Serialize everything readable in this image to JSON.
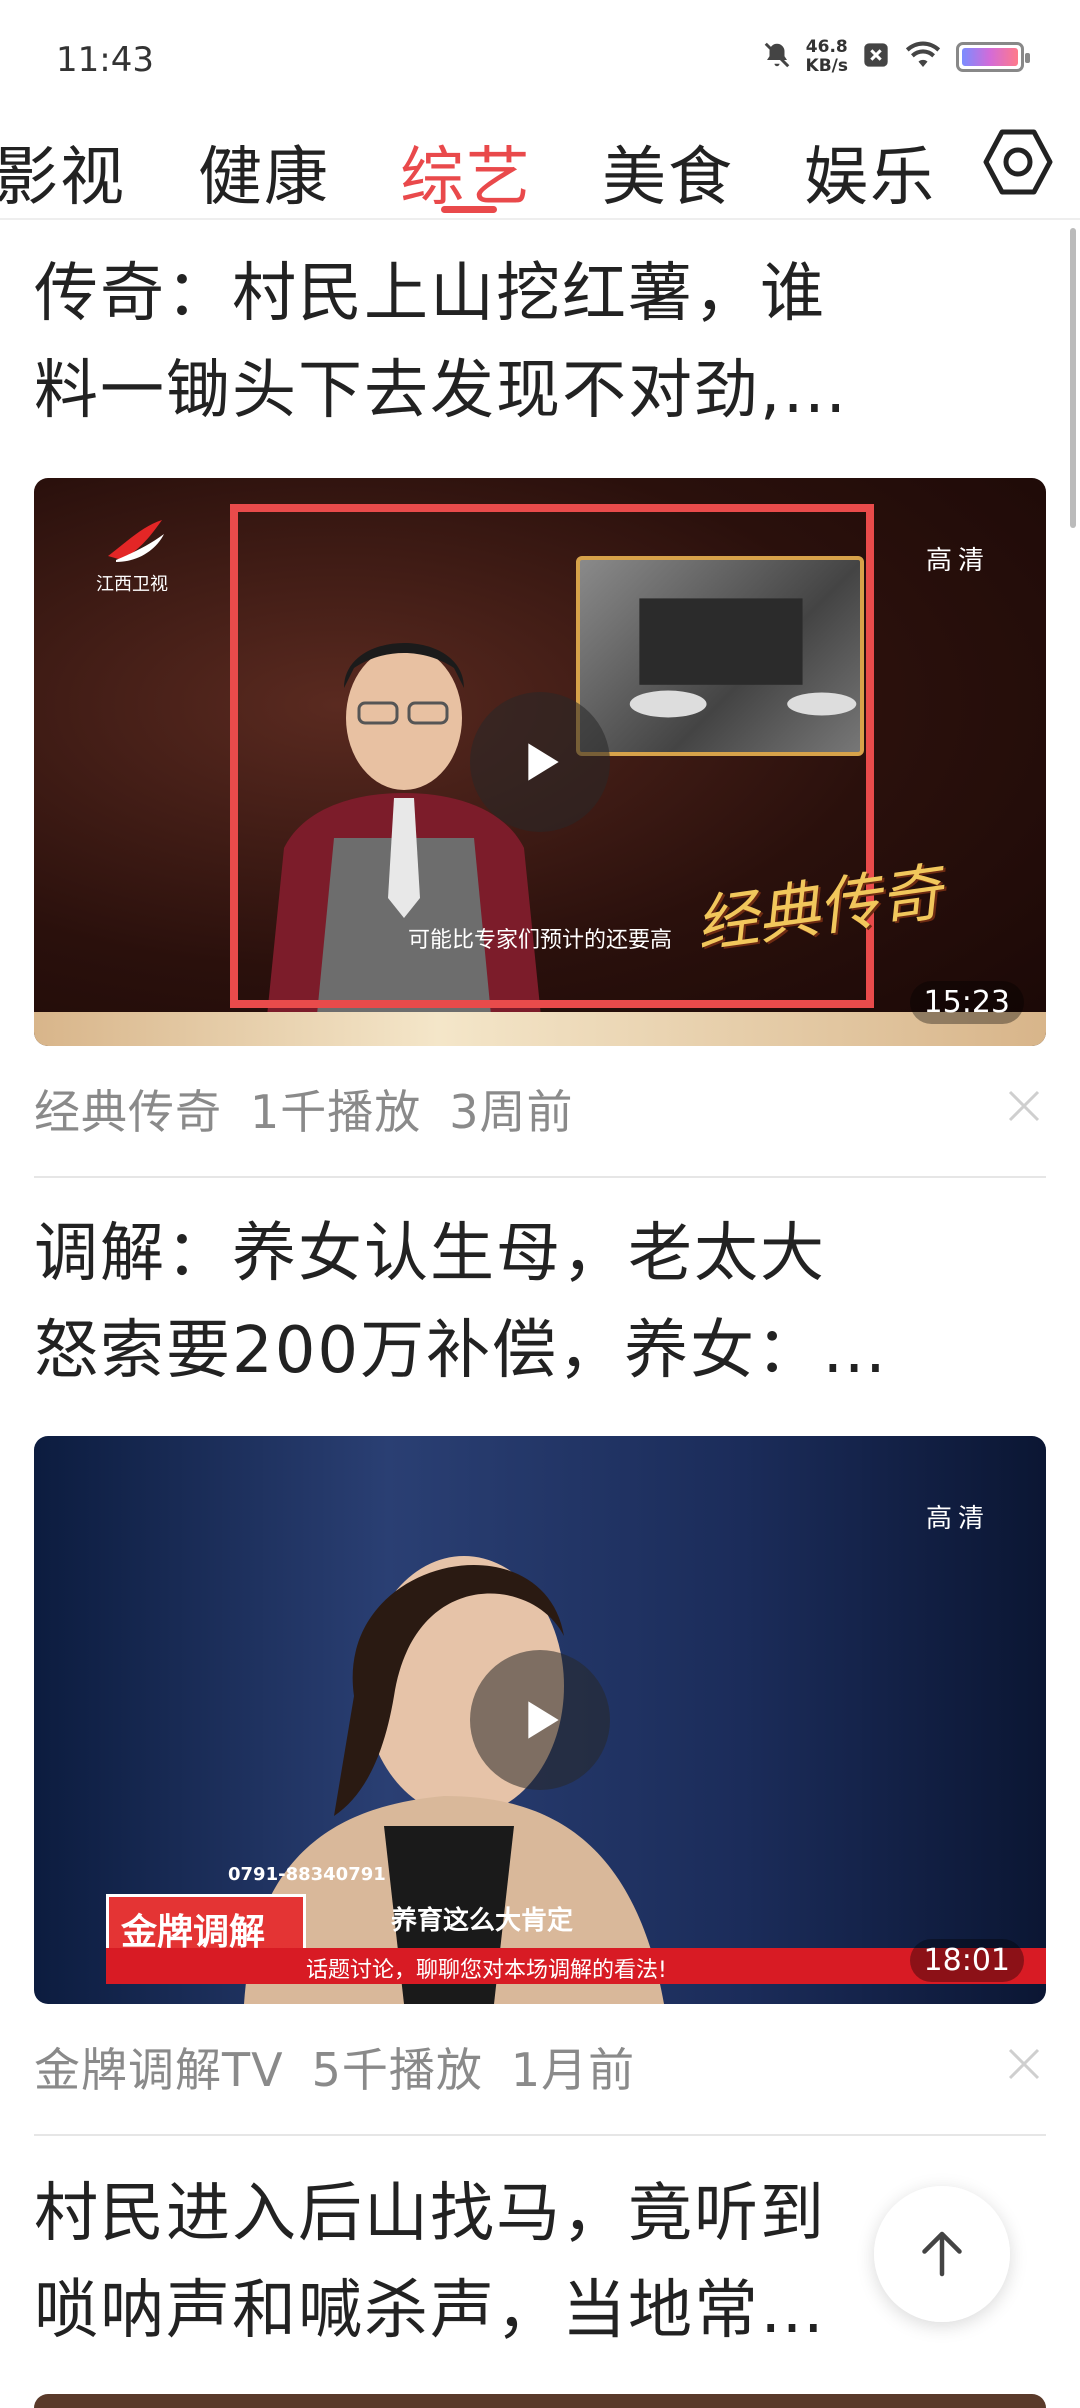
{
  "status_bar": {
    "time": "11:43",
    "net_speed_value": "46.8",
    "net_speed_unit": "KB/s",
    "icons": [
      "mute-icon",
      "speed-icon",
      "close-box-icon",
      "wifi-icon",
      "battery-icon"
    ]
  },
  "tabs": {
    "items": [
      {
        "label": "影视"
      },
      {
        "label": "健康"
      },
      {
        "label": "综艺",
        "active": true
      },
      {
        "label": "美食"
      },
      {
        "label": "娱乐"
      }
    ],
    "settings_icon": "gear-icon",
    "accent_color": "#e9494b"
  },
  "feed": {
    "cards": [
      {
        "title_line1": "传奇：村民上山挖红薯，谁",
        "title_line2": "料一锄头下去发现不对劲,…",
        "quality": "高清",
        "duration": "15:23",
        "video": {
          "channel_logo_text": "江西卫视",
          "caption": "可能比专家们预计的还要高",
          "brand": "经典传奇"
        },
        "meta": {
          "source": "经典传奇",
          "plays": "1千播放",
          "time": "3周前"
        }
      },
      {
        "title_line1": "调解：养女认生母，老太大",
        "title_line2": "怒索要200万补偿，养女：…",
        "quality": "高清",
        "duration": "18:01",
        "video": {
          "phone": "0791-88340791",
          "badge": "金牌调解",
          "subtitle": "养育这么大肯定",
          "ticker": "话题讨论，聊聊您对本场调解的看法!"
        },
        "meta": {
          "source": "金牌调解TV",
          "plays": "5千播放",
          "time": "1月前"
        }
      },
      {
        "title_line1": "村民进入后山找马，竟听到",
        "title_line2": "唢呐声和喊杀声，当地常…"
      }
    ]
  },
  "back_to_top_icon": "arrow-up-icon"
}
